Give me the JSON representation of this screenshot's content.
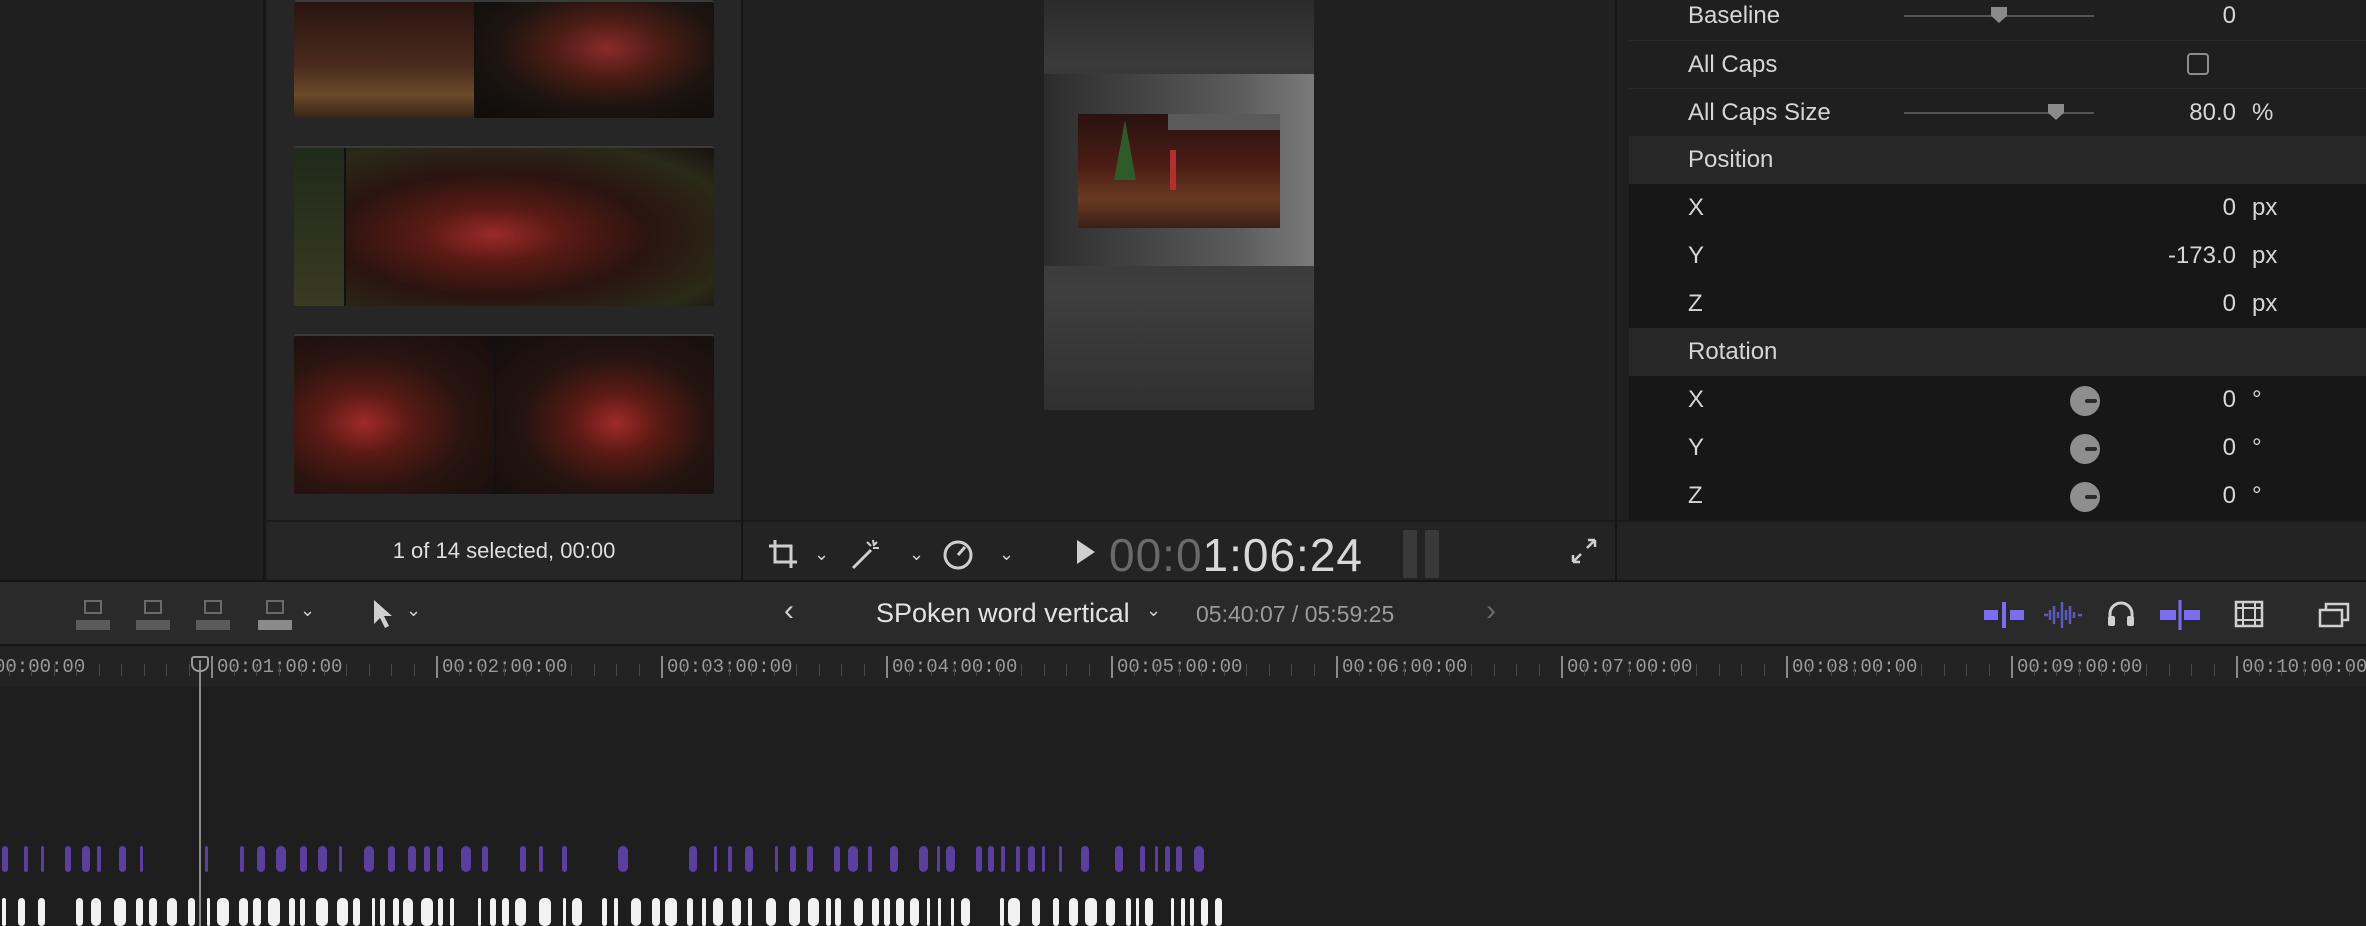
{
  "browser": {
    "status": "1 of 14 selected, 00:00"
  },
  "viewer": {
    "timecode_dim": "00:0",
    "timecode_lit": "1:06:24"
  },
  "inspector": {
    "baseline": {
      "label": "Baseline",
      "value": "0",
      "slider_fraction": 0.5
    },
    "all_caps": {
      "label": "All Caps",
      "checked": false
    },
    "all_caps_size": {
      "label": "All Caps Size",
      "value": "80.0",
      "unit": "%",
      "slider_fraction": 0.8
    },
    "position": {
      "title": "Position",
      "x": {
        "label": "X",
        "value": "0",
        "unit": "px"
      },
      "y": {
        "label": "Y",
        "value": "-173.0",
        "unit": "px"
      },
      "z": {
        "label": "Z",
        "value": "0",
        "unit": "px"
      }
    },
    "rotation": {
      "title": "Rotation",
      "x": {
        "label": "X",
        "value": "0",
        "unit": "°"
      },
      "y": {
        "label": "Y",
        "value": "0",
        "unit": "°"
      },
      "z": {
        "label": "Z",
        "value": "0",
        "unit": "°"
      }
    }
  },
  "timeline": {
    "project_name": "SPoken word vertical",
    "project_time": "05:40:07 / 05:59:25",
    "ruler": [
      "00:00:00",
      "00:01:00:00",
      "00:02:00:00",
      "00:03:00:00",
      "00:04:00:00",
      "00:05:00:00",
      "00:06:00:00",
      "00:07:00:00",
      "00:08:00:00",
      "00:09:00:00",
      "00:10:00:00"
    ],
    "colors": {
      "accent": "#7b6cf0",
      "marker_purple": "#5a3f9e",
      "marker_white": "#f2f2f2"
    }
  },
  "icons": {
    "play": "play-icon",
    "crop": "crop-icon",
    "enhance": "magic-wand-icon",
    "retime": "speedometer-icon",
    "fullscreen": "fullscreen-icon"
  }
}
